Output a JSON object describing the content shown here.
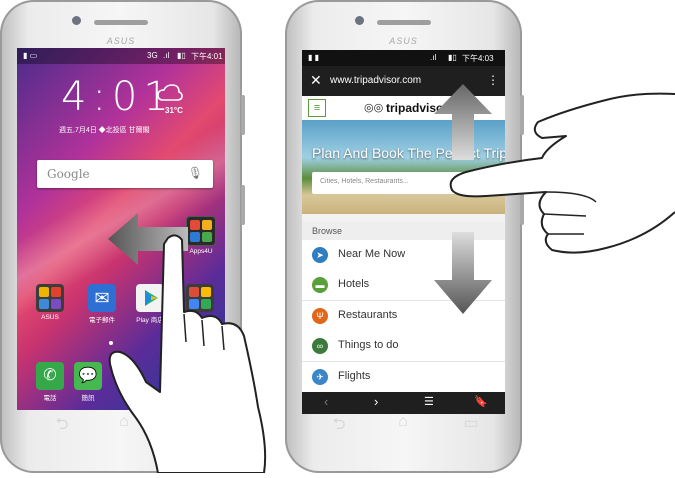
{
  "left_phone": {
    "brand": "ASUS",
    "status": {
      "network": "3G",
      "time": "下午4:01"
    },
    "clock": {
      "time": "4:01",
      "date": "週五,7月4日 ◆北投區 甘爾閣",
      "temp": "31°C"
    },
    "search": {
      "placeholder": "Google"
    },
    "apps": {
      "folder_right": "Apps4U",
      "asus": "ASUS",
      "email": "電子郵件",
      "play": "Play 商店",
      "phone": "電話",
      "messages": "簡訊"
    }
  },
  "right_phone": {
    "brand": "ASUS",
    "status": {
      "time": "下午4:03"
    },
    "browser": {
      "url": "www.tripadvisor.com"
    },
    "tripadvisor": {
      "logo": "tripadvisor",
      "hero_title": "Plan And Book The Perfect Trip",
      "search_placeholder": "Cities, Hotels, Restaurants..."
    },
    "browse": {
      "header": "Browse",
      "items": [
        {
          "label": "Near Me Now",
          "icon": "navigation-arrow-icon",
          "color": "#2f7ec2"
        },
        {
          "label": "Hotels",
          "icon": "bed-icon",
          "color": "#5aa03a"
        },
        {
          "label": "Restaurants",
          "icon": "fork-knife-icon",
          "color": "#e0661a"
        },
        {
          "label": "Things to do",
          "icon": "binoculars-icon",
          "color": "#3b7a3b"
        },
        {
          "label": "Flights",
          "icon": "plane-icon",
          "color": "#3b86c6"
        }
      ]
    }
  }
}
